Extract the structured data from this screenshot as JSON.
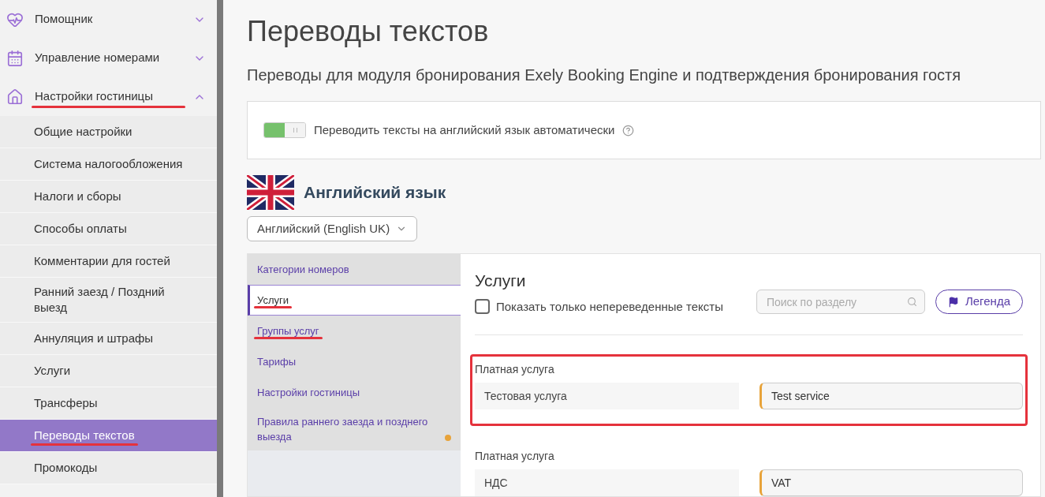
{
  "sidebar": {
    "sections": [
      {
        "label": "Помощник",
        "kind": "heart",
        "expanded": false,
        "underlined": false
      },
      {
        "label": "Управление номерами",
        "kind": "calendar",
        "expanded": false,
        "underlined": false
      },
      {
        "label": "Настройки гостиницы",
        "kind": "home",
        "expanded": true,
        "underlined": true
      }
    ],
    "items": [
      {
        "label": "Общие настройки",
        "selected": false,
        "underlined": false
      },
      {
        "label": "Система налогообложения",
        "selected": false,
        "underlined": false
      },
      {
        "label": "Налоги и сборы",
        "selected": false,
        "underlined": false
      },
      {
        "label": "Способы оплаты",
        "selected": false,
        "underlined": false
      },
      {
        "label": "Комментарии для гостей",
        "selected": false,
        "underlined": false
      },
      {
        "label": "Ранний заезд / Поздний выезд",
        "selected": false,
        "underlined": false
      },
      {
        "label": "Аннуляция и штрафы",
        "selected": false,
        "underlined": false
      },
      {
        "label": "Услуги",
        "selected": false,
        "underlined": false
      },
      {
        "label": "Трансферы",
        "selected": false,
        "underlined": false
      },
      {
        "label": "Переводы текстов",
        "selected": true,
        "underlined": true
      },
      {
        "label": "Промокоды",
        "selected": false,
        "underlined": false
      }
    ]
  },
  "page": {
    "title": "Переводы текстов",
    "subtitle": "Переводы для модуля бронирования Exely Booking Engine и подтверждения бронирования гостя"
  },
  "auto_translate": {
    "label": "Переводить тексты на английский язык автоматически",
    "on": true
  },
  "language": {
    "heading": "Английский язык",
    "dropdown": "Английский (English UK)"
  },
  "sections_nav": [
    {
      "label": "Категории номеров",
      "selected": false,
      "underlined": false,
      "dot": false
    },
    {
      "label": "Услуги",
      "selected": true,
      "underlined": true,
      "dot": false
    },
    {
      "label": "Группы услуг",
      "selected": false,
      "underlined": true,
      "dot": false
    },
    {
      "label": "Тарифы",
      "selected": false,
      "underlined": false,
      "dot": false
    },
    {
      "label": "Настройки гостиницы",
      "selected": false,
      "underlined": false,
      "dot": false
    },
    {
      "label": "Правила раннего заезда и позднего выезда",
      "selected": false,
      "underlined": false,
      "dot": true
    }
  ],
  "content": {
    "title": "Услуги",
    "filter": {
      "label": "Показать только непереведенные тексты",
      "checked": false
    },
    "search": {
      "placeholder": "Поиск по разделу"
    },
    "legend_button": "Легенда",
    "entries": [
      {
        "group": "Платная услуга",
        "source": "Тестовая услуга",
        "translation": "Test service",
        "highlighted": true
      },
      {
        "group": "Платная услуга",
        "source": "НДС",
        "translation": "VAT",
        "highlighted": false
      }
    ]
  }
}
